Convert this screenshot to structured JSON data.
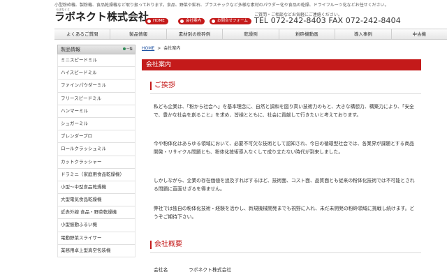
{
  "header": {
    "tagline": "小型粉砕機、製粉機、食品乾燥機など取り扱っております。食品、野菜や鉱石、プラスチックなど多様な素材のパウダー化や食品の乾燥、ドライフルーツ化などお任せください。",
    "logo_ruby": "らぼねくと",
    "logo_text": "ラボネクト株式会社",
    "buttons": {
      "home": "HOME",
      "company": "会社案内",
      "contact": "お問合せフォーム"
    },
    "contact_note": "ご質問・ご相談などお気軽にご連絡ください。",
    "phone_fax": "TEL 072-242-8403  FAX 072-242-8404"
  },
  "nav": {
    "items": [
      "よくあるご質問",
      "製品情報",
      "素材別の粉砕例",
      "乾燥例",
      "粉砕機動画",
      "導入事例",
      "中古機"
    ]
  },
  "sidebar": {
    "title": "製品情報",
    "list_button": "一覧",
    "items": [
      "ミニスピードミル",
      "ハイスピードミル",
      "ファインパウダーミル",
      "フリースピードミル",
      "ハンマーミル",
      "シュガーミル",
      "ブレンダープロ",
      "ロールクラッシュミル",
      "カットクラッシャー",
      "ドラミニ（家庭用食品乾燥機）",
      "小型～中型食品乾燥機",
      "大型電気食品乾燥機",
      "近赤外線 食品・野菜乾燥機",
      "小型振動ふるい機",
      "電動野菜スライサー",
      "業務用卓上型真空包装機"
    ]
  },
  "breadcrumb": {
    "home": "HOME",
    "separator": ">",
    "current": "会社案内"
  },
  "page_title": "会社案内",
  "greeting": {
    "title": "ご挨拶",
    "paragraphs": [
      "私ども企業は、「粉から社会へ」を基本理念に、自然と調和を図り高い技術力のもと、大きな構想力、構築力により、「安全で、豊かな社会を創ること」を求め、皆様とともに、社会に貢献して行きたいと考えております。",
      "今や粉体化はあらゆる領域において、必要不可欠な技術として認知され、今日の循環型社会では、各業界が課題とする商品開発・リサイクル問題とも、粉体化技術導入なくして成り立たない時代が到来しました。",
      "しかしながら、企業の存在価値を追及すればするほど、技術面、コスト面、品質面とも従来の粉体化技術では不可能とされる問題に直面せざるを得ません。",
      "弊社では独自の粉体化技術・経験を活かし、新規機械開発までも視野に入れ、未だ未開発の粉砕領域に挑戦し続けます。どうぞご期待下さい。"
    ]
  },
  "overview": {
    "title": "会社概要",
    "rows": [
      {
        "label": "会社名",
        "value": "ラボネクト株式会社"
      }
    ]
  },
  "colors": {
    "accent": "#c41a1a",
    "link": "#1a4fa0"
  }
}
